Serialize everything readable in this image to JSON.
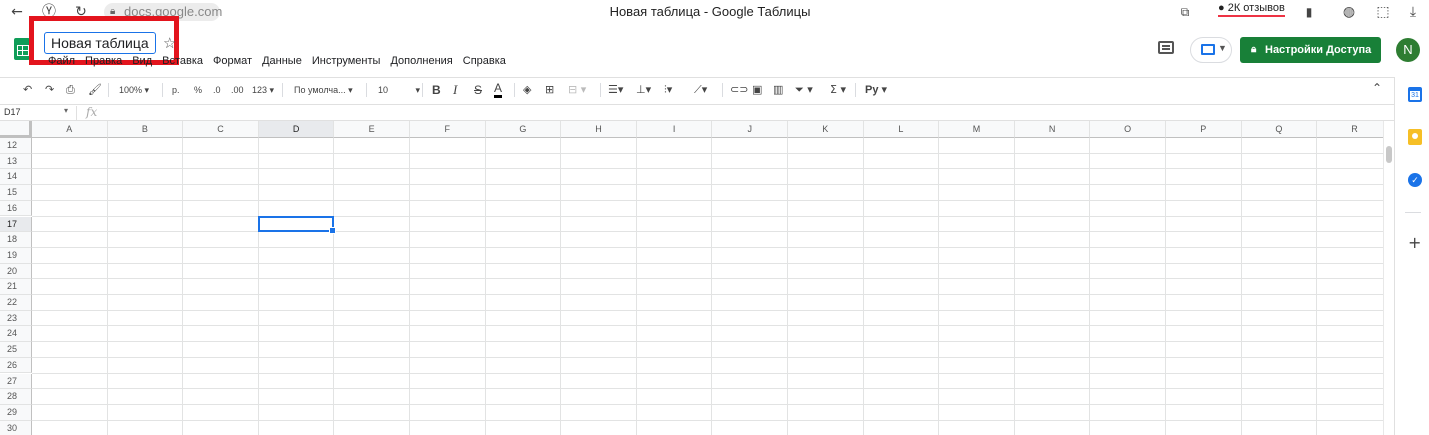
{
  "browser": {
    "url": "docs.google.com",
    "window_title": "Новая таблица - Google Таблицы",
    "reviews": "2К отзывов"
  },
  "doc": {
    "title": "Новая таблица"
  },
  "menu": [
    "Файл",
    "Правка",
    "Вид",
    "Вставка",
    "Формат",
    "Данные",
    "Инструменты",
    "Дополнения",
    "Справка"
  ],
  "share_label": "Настройки Доступа",
  "avatar_initial": "N",
  "toolbar": {
    "zoom": "100%",
    "currency": "р.",
    "percent": "%",
    "dec_decrease": ".0",
    "dec_increase": ".00",
    "format_more": "123",
    "font": "По умолча...",
    "font_size": "10",
    "bold": "B",
    "italic": "I",
    "strike": "S",
    "text_color": "A",
    "sum": "Σ",
    "input_tools": "Pу"
  },
  "formula_bar": {
    "cell_ref": "D17",
    "fx": "fx"
  },
  "grid": {
    "columns": [
      "A",
      "B",
      "C",
      "D",
      "E",
      "F",
      "G",
      "H",
      "I",
      "J",
      "K",
      "L",
      "M",
      "N",
      "O",
      "P",
      "Q",
      "R"
    ],
    "rows": [
      "12",
      "13",
      "14",
      "15",
      "16",
      "17",
      "18",
      "19",
      "20",
      "21",
      "22",
      "23",
      "24",
      "25",
      "26",
      "27",
      "28",
      "29",
      "30"
    ],
    "selected_column": "D",
    "selected_row": "17"
  },
  "sidebar": {
    "calendar_day": "31",
    "add": "+"
  },
  "colors": {
    "accent": "#1a73e8",
    "share_button": "#188038",
    "highlight": "#e3141d",
    "sheets_logo": "#0f9d58"
  }
}
